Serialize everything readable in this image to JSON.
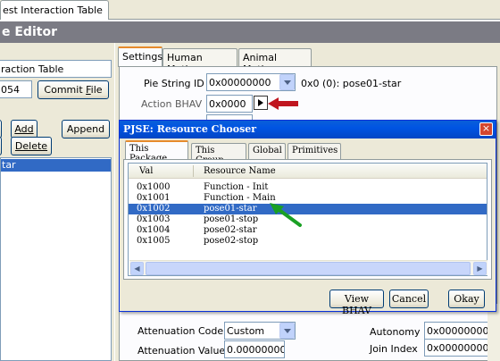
{
  "document_tab": {
    "label": "est Interaction Table"
  },
  "header": {
    "title": "e Editor"
  },
  "left_pane": {
    "name_value": "raction Table",
    "number_value": "054",
    "commit_file_label": "Commit File",
    "add_label": "Add",
    "append_label": "Append",
    "delete_label": "Delete",
    "list_items": [
      "tar"
    ]
  },
  "settings_tabs": [
    "Settings",
    "Human Motives",
    "Animal Motives"
  ],
  "settings": {
    "pie_string_id_label": "Pie String ID",
    "pie_string_id_value": "0x00000000",
    "pie_string_id_info": "0x0 (0): pose01-star",
    "action_bhav_label": "Action BHAV",
    "action_bhav_value": "0x0000",
    "attenuation_code_label": "Attenuation Code",
    "attenuation_code_value": "Custom",
    "attenuation_value_label": "Attenuation Value",
    "attenuation_value_value": "0.00000000",
    "autonomy_label": "Autonomy",
    "autonomy_value": "0x00000000",
    "join_index_label": "Join Index",
    "join_index_value": "0x00000000"
  },
  "dialog": {
    "title": "PJSE: Resource Chooser",
    "close_glyph": "×",
    "tabs": [
      "This Package",
      "This Group",
      "Global",
      "Primitives"
    ],
    "columns": [
      "Val",
      "Resource Name"
    ],
    "rows": [
      {
        "val": "0x1000",
        "name": "Function - Init"
      },
      {
        "val": "0x1001",
        "name": "Function - Main"
      },
      {
        "val": "0x1002",
        "name": "pose01-star"
      },
      {
        "val": "0x1003",
        "name": "pose01-stop"
      },
      {
        "val": "0x1004",
        "name": "pose02-star"
      },
      {
        "val": "0x1005",
        "name": "pose02-stop"
      }
    ],
    "selected_row": 2,
    "view_bhav_label": "View BHAV",
    "cancel_label": "Cancel",
    "okay_label": "Okay"
  },
  "colors": {
    "header_bar": "#7b7b84",
    "title_bar": "#0054e3",
    "selection": "#316ac5",
    "red_arrow": "#c0161f",
    "green_arrow": "#1aa024",
    "active_tab_accent": "#e68b2c"
  }
}
